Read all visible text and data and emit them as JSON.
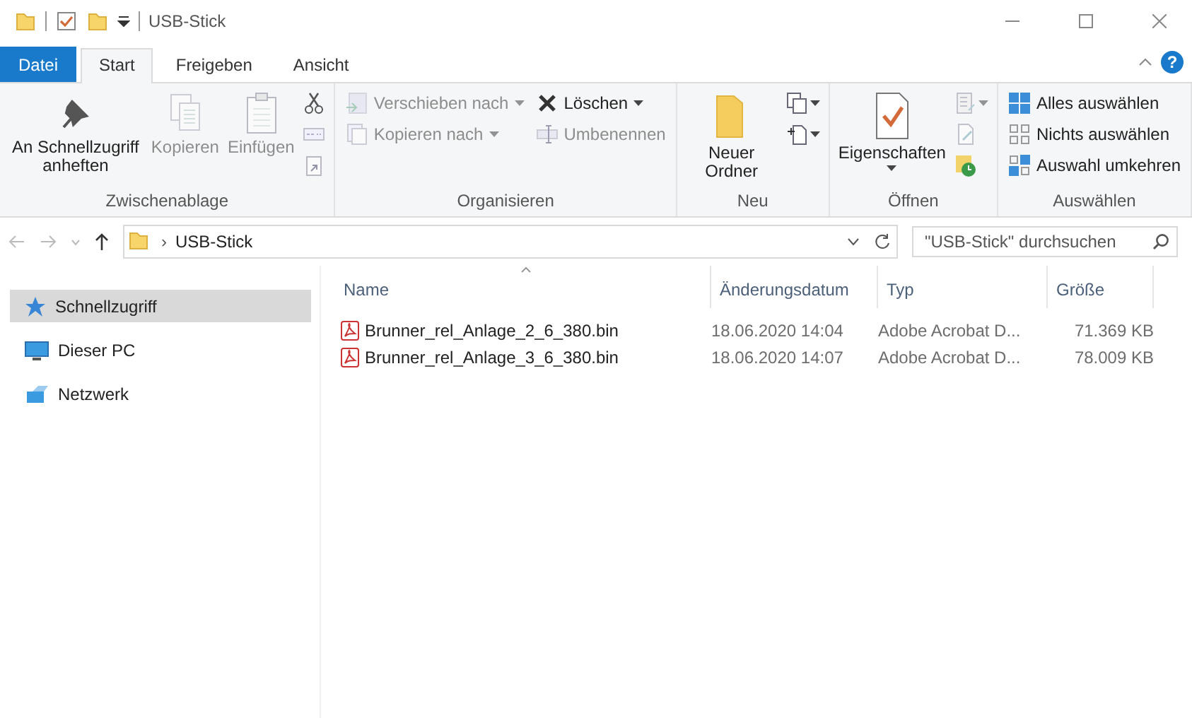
{
  "window": {
    "title": "USB-Stick",
    "help": "?"
  },
  "tabs": [
    {
      "label": "Datei",
      "kind": "file",
      "selected": false
    },
    {
      "label": "Start",
      "kind": "tab",
      "selected": true
    },
    {
      "label": "Freigeben",
      "kind": "tab",
      "selected": false
    },
    {
      "label": "Ansicht",
      "kind": "tab",
      "selected": false
    }
  ],
  "ribbon_groups": [
    {
      "label": "Zwischenablage",
      "items": [
        {
          "kind": "large",
          "label": "An Schnellzugriff anheften",
          "disabled": false,
          "dropdown": false
        },
        {
          "kind": "large",
          "label": "Kopieren",
          "disabled": true,
          "dropdown": false
        },
        {
          "kind": "large",
          "label": "Einfügen",
          "disabled": true,
          "dropdown": false
        },
        {
          "kind": "tool",
          "disabled": false,
          "dropdown": false
        },
        {
          "kind": "tool",
          "disabled": true,
          "dropdown": false
        },
        {
          "kind": "tool",
          "disabled": true,
          "dropdown": false
        }
      ]
    },
    {
      "label": "Organisieren",
      "items": [
        {
          "kind": "small",
          "label": "Verschieben nach",
          "disabled": true,
          "dropdown": true
        },
        {
          "kind": "small",
          "label": "Kopieren nach",
          "disabled": true,
          "dropdown": true
        },
        {
          "kind": "small",
          "label": "Löschen",
          "disabled": false,
          "dropdown": true
        },
        {
          "kind": "small",
          "label": "Umbenennen",
          "disabled": true,
          "dropdown": false
        }
      ]
    },
    {
      "label": "Neu",
      "items": [
        {
          "kind": "large",
          "label": "Neuer Ordner",
          "disabled": false,
          "dropdown": false
        },
        {
          "kind": "tool",
          "disabled": false,
          "dropdown": true
        },
        {
          "kind": "tool",
          "disabled": false,
          "dropdown": true
        }
      ]
    },
    {
      "label": "Öffnen",
      "items": [
        {
          "kind": "large",
          "label": "Eigenschaften",
          "disabled": false,
          "dropdown": true
        },
        {
          "kind": "tool",
          "disabled": true,
          "dropdown": true
        },
        {
          "kind": "tool",
          "disabled": true,
          "dropdown": false
        },
        {
          "kind": "tool",
          "disabled": false,
          "dropdown": false
        }
      ]
    },
    {
      "label": "Auswählen",
      "items": [
        {
          "kind": "small",
          "label": "Alles auswählen",
          "disabled": false,
          "dropdown": false
        },
        {
          "kind": "small",
          "label": "Nichts auswählen",
          "disabled": false,
          "dropdown": false
        },
        {
          "kind": "small",
          "label": "Auswahl umkehren",
          "disabled": false,
          "dropdown": false
        }
      ]
    }
  ],
  "address_bar": {
    "separator": "›",
    "path": "USB-Stick"
  },
  "search": {
    "placeholder": "\"USB-Stick\" durchsuchen"
  },
  "sidebar": {
    "items": [
      {
        "label": "Schnellzugriff",
        "selected": true
      },
      {
        "label": "Dieser PC",
        "selected": false
      },
      {
        "label": "Netzwerk",
        "selected": false
      }
    ]
  },
  "table": {
    "columns": [
      {
        "label": "Name",
        "sorted": true
      },
      {
        "label": "Änderungsdatum",
        "sorted": false
      },
      {
        "label": "Typ",
        "sorted": false
      },
      {
        "label": "Größe",
        "sorted": false
      }
    ],
    "rows": [
      {
        "name": "Brunner_rel_Anlage_2_6_380.bin",
        "date": "18.06.2020 14:04",
        "type": "Adobe Acrobat D...",
        "size": "71.369 KB"
      },
      {
        "name": "Brunner_rel_Anlage_3_6_380.bin",
        "date": "18.06.2020 14:07",
        "type": "Adobe Acrobat D...",
        "size": "78.009 KB"
      }
    ]
  }
}
